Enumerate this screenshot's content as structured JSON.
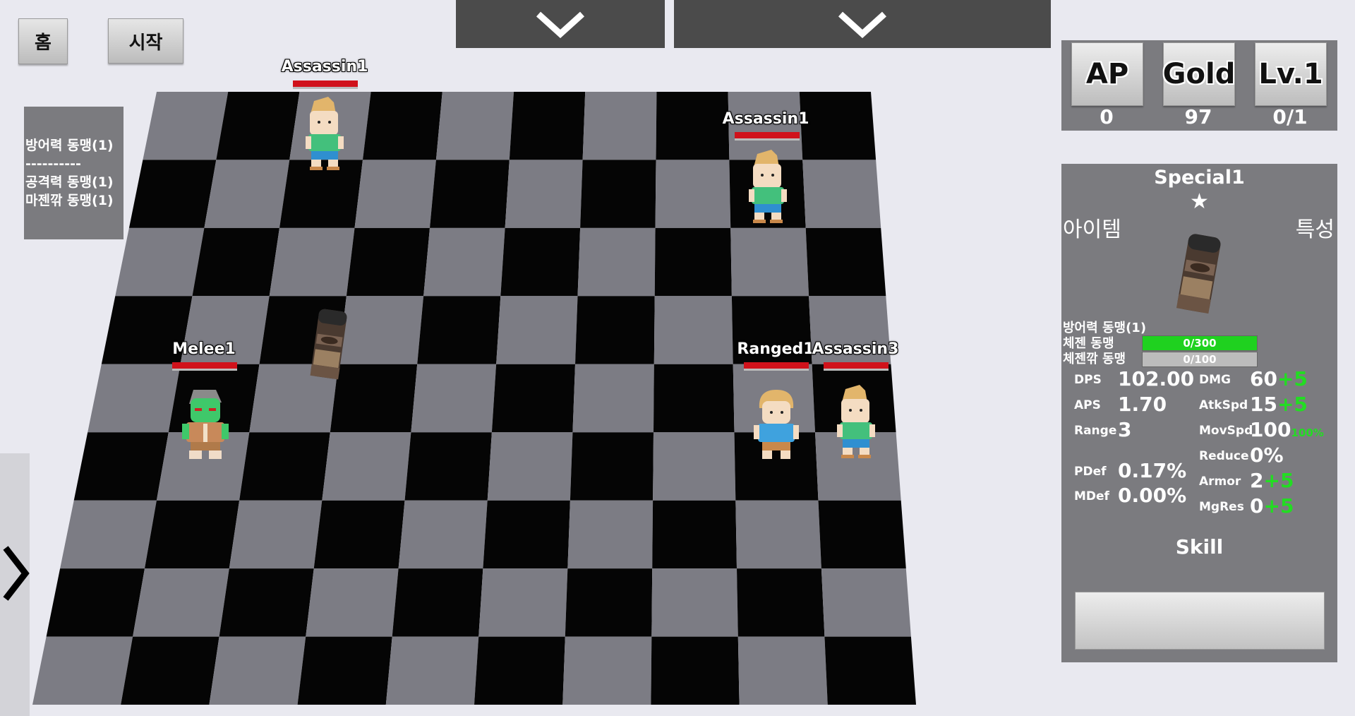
{
  "top_buttons": {
    "home": "홈",
    "start": "시작"
  },
  "synergy_panel": {
    "lines": [
      "방어력 동맹(1)",
      "----------",
      "공격력 동맹(1)",
      "마젠깎 동맹(1)"
    ]
  },
  "units": [
    {
      "name": "Assassin1",
      "kind": "assassin"
    },
    {
      "name": "Assassin1",
      "kind": "assassin"
    },
    {
      "name": "Melee1",
      "kind": "melee"
    },
    {
      "name": "Ranged1",
      "kind": "ranged"
    },
    {
      "name": "Assassin3",
      "kind": "assassin"
    }
  ],
  "resources": {
    "ap_label": "AP",
    "ap_value": "0",
    "gold_label": "Gold",
    "gold_value": "97",
    "level_label": "Lv.1",
    "level_value": "0/1"
  },
  "info": {
    "title": "Special1",
    "star": "★",
    "tab_item": "아이템",
    "tab_trait": "특성",
    "synergies": [
      "방어력 동맹(1)",
      "체젠 동맹",
      "체젠깎 동맹"
    ],
    "bars": [
      {
        "text": "0/300",
        "fill": 0.0,
        "color": "#1fd11f"
      },
      {
        "text": "0/100",
        "fill": 0.0,
        "color": "#bcbcbc"
      }
    ],
    "stats": {
      "dps_label": "DPS",
      "dps": "102.00",
      "aps_label": "APS",
      "aps": "1.70",
      "range_label": "Range",
      "range": "3",
      "pdef_label": "PDef",
      "pdef": "0.17%",
      "mdef_label": "MDef",
      "mdef": "0.00%",
      "dmg_label": "DMG",
      "dmg": "60",
      "dmg_bonus": "+5",
      "atkspd_label": "AtkSpd",
      "atkspd": "15",
      "atkspd_bonus": "+5",
      "movspd_label": "MovSpd",
      "movspd": "100",
      "movspd_bonus": "100%",
      "reduce_label": "Reduce",
      "reduce": "0%",
      "armor_label": "Armor",
      "armor": "2",
      "armor_bonus": "+5",
      "mgres_label": "MgRes",
      "mgres": "0",
      "mgres_bonus": "+5"
    },
    "skill_label": "Skill"
  },
  "colors": {
    "panel": "#7b7b7f",
    "hp": "#d0121b",
    "bonus": "#22dd22"
  }
}
